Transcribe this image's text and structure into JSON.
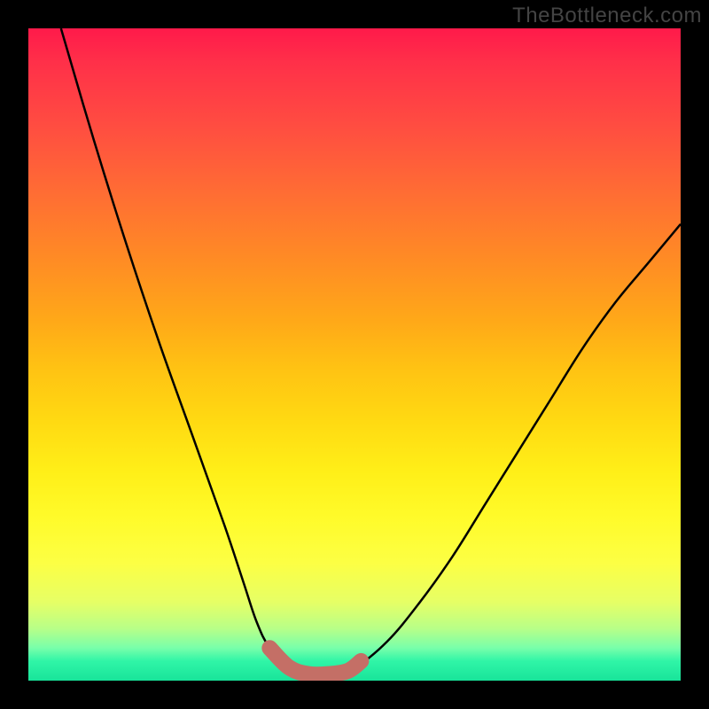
{
  "watermark": "TheBottleneck.com",
  "colors": {
    "frame": "#000000",
    "curve": "#000000",
    "marker": "#c46f66",
    "gradient_top": "#ff1a4a",
    "gradient_bottom": "#18e49a"
  },
  "chart_data": {
    "type": "line",
    "title": "",
    "xlabel": "",
    "ylabel": "",
    "xlim": [
      0,
      100
    ],
    "ylim": [
      0,
      100
    ],
    "grid": false,
    "legend": false,
    "annotations": [
      "TheBottleneck.com"
    ],
    "series": [
      {
        "name": "bottleneck-curve",
        "x": [
          5,
          10,
          15,
          20,
          25,
          30,
          33,
          35,
          37,
          40,
          43,
          46,
          50,
          55,
          60,
          65,
          70,
          75,
          80,
          85,
          90,
          95,
          100
        ],
        "y": [
          100,
          83,
          67,
          52,
          38,
          24,
          15,
          9,
          5,
          2,
          1,
          1,
          2,
          6,
          12,
          19,
          27,
          35,
          43,
          51,
          58,
          64,
          70
        ]
      }
    ],
    "markers": {
      "name": "optimal-range",
      "x": [
        37,
        40,
        43,
        46,
        49,
        51
      ],
      "y": [
        5,
        2,
        1,
        1,
        1.5,
        3
      ]
    }
  }
}
